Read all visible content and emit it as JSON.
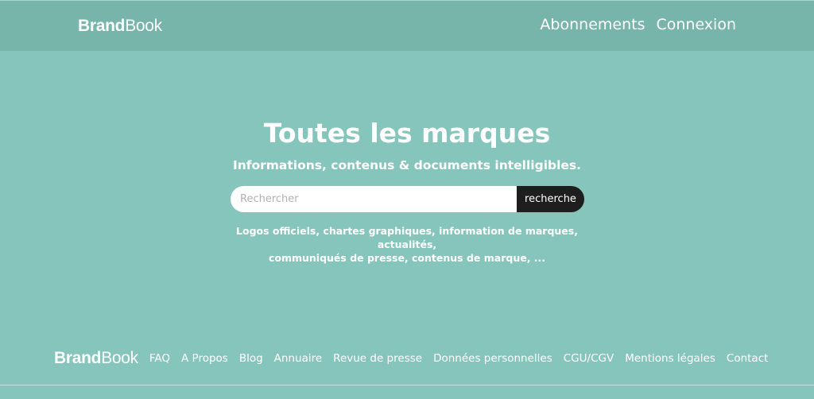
{
  "header": {
    "logo": {
      "bold": "Brand",
      "regular": "Book"
    },
    "nav": [
      {
        "label": "Abonnements"
      },
      {
        "label": "Connexion"
      }
    ]
  },
  "hero": {
    "title": "Toutes les marques",
    "subtitle": "Informations, contenus & documents intelligibles.",
    "search": {
      "placeholder": "Rechercher",
      "value": "",
      "button_label": "recherche"
    },
    "description_line1": "Logos officiels, chartes graphiques, information de marques, actualités,",
    "description_line2": "communiqués de presse, contenus de marque, ..."
  },
  "footer": {
    "logo": {
      "bold": "Brand",
      "regular": "Book"
    },
    "links": [
      {
        "label": "FAQ"
      },
      {
        "label": "A Propos"
      },
      {
        "label": "Blog"
      },
      {
        "label": "Annuaire"
      },
      {
        "label": "Revue de presse"
      },
      {
        "label": "Données personnelles"
      },
      {
        "label": "CGU/CGV"
      },
      {
        "label": "Mentions légales"
      },
      {
        "label": "Contact"
      }
    ]
  },
  "colors": {
    "background": "#86c5bb",
    "header_background": "#77b5ab",
    "search_button": "#1e1e1e",
    "text": "#ffffff"
  }
}
